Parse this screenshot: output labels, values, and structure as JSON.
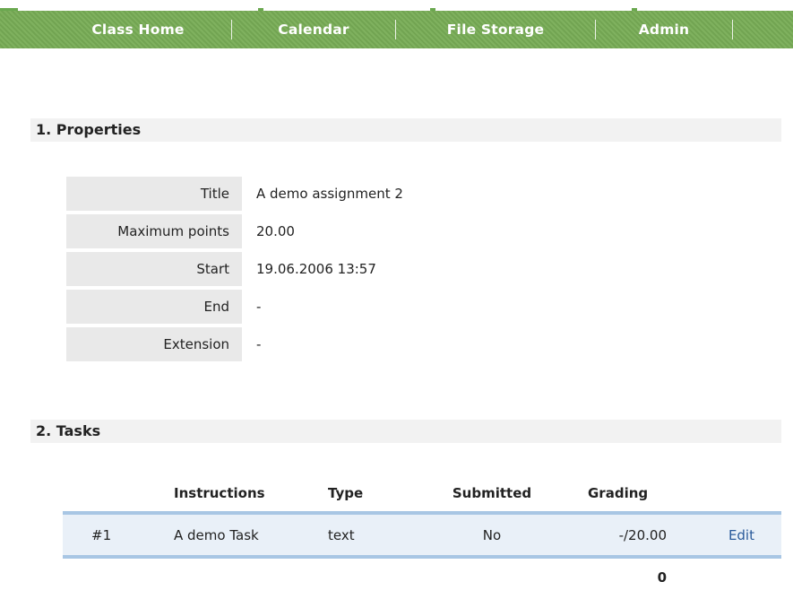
{
  "nav": {
    "items": [
      {
        "label": "Class Home"
      },
      {
        "label": "Calendar"
      },
      {
        "label": "File Storage"
      },
      {
        "label": "Admin"
      }
    ]
  },
  "sections": {
    "properties": "1. Properties",
    "tasks": "2. Tasks"
  },
  "properties": [
    {
      "label": "Title",
      "value": "A demo assignment 2"
    },
    {
      "label": "Maximum points",
      "value": "20.00"
    },
    {
      "label": "Start",
      "value": "19.06.2006 13:57"
    },
    {
      "label": "End",
      "value": "-"
    },
    {
      "label": "Extension",
      "value": "-"
    }
  ],
  "tasks": {
    "headers": {
      "number": "",
      "instructions": "Instructions",
      "type": "Type",
      "submitted": "Submitted",
      "grading": "Grading"
    },
    "rows": [
      {
        "number": "#1",
        "instructions": "A demo Task",
        "type": "text",
        "submitted": "No",
        "grading": "-/20.00",
        "action": "Edit"
      }
    ],
    "total": "0"
  },
  "colors": {
    "nav_bg": "#78ad56",
    "header_bg": "#f2f2f2",
    "label_bg": "#e9e9e9",
    "row_bg": "#e9f0f8",
    "rule": "#a8c6e4",
    "link": "#2a5a9a"
  }
}
